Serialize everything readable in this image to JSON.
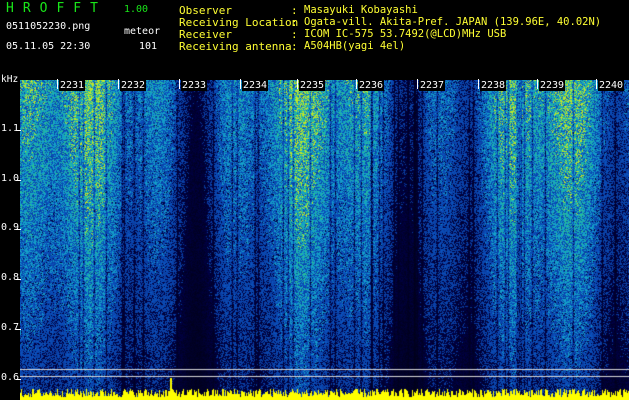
{
  "header": {
    "app_title": "HROFFT",
    "version": "1.00",
    "file_name": "0511052230.png",
    "mode": "meteor",
    "timestamp": "05.11.05 22:30",
    "count": "101"
  },
  "info": [
    {
      "label": "Observer",
      "value": "Masayuki Kobayashi"
    },
    {
      "label": "Receiving Location",
      "value": "Ogata-vill. Akita-Pref. JAPAN (139.96E, 40.02N)"
    },
    {
      "label": "Receiver",
      "value": "ICOM IC-575 53.7492(@LCD)MHz USB"
    },
    {
      "label": "Receiving antenna",
      "value": "A504HB(yagi 4el)"
    }
  ],
  "spectrogram": {
    "frequency_unit": "kHz",
    "y_ticks": [
      "1.1",
      "1.0",
      "0.9",
      "0.8",
      "0.7",
      "0.6"
    ],
    "time_labels": [
      "2231",
      "2232",
      "2233",
      "2234",
      "2235",
      "2236",
      "2237",
      "2238",
      "2239",
      "2240"
    ],
    "colors": {
      "background": "#000000",
      "low": "#0a1f8a",
      "mid": "#1a6fd6",
      "high": "#33cc99",
      "peak": "#ccee22",
      "baseline": "#ffff00",
      "header_text": "#ffff33",
      "title_text": "#19e619"
    }
  }
}
